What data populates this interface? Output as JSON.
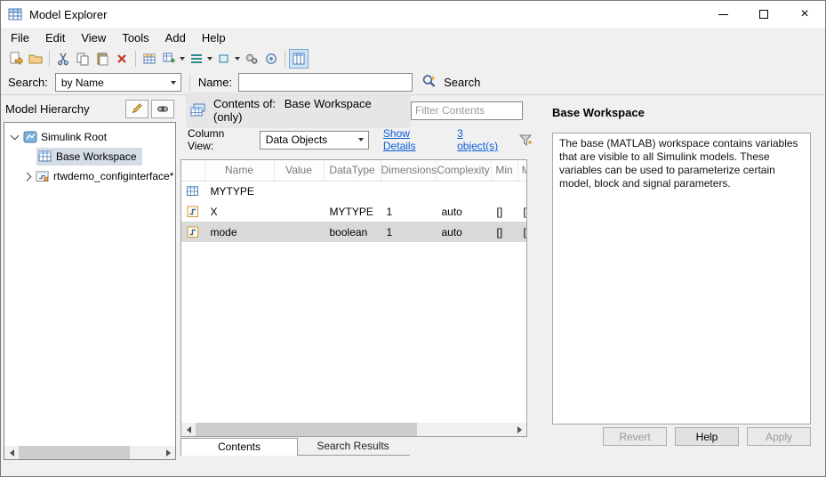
{
  "window": {
    "title": "Model Explorer"
  },
  "menu": {
    "items": [
      "File",
      "Edit",
      "View",
      "Tools",
      "Add",
      "Help"
    ]
  },
  "toolbar": {
    "icons": [
      "new-model-icon",
      "open-icon",
      "cut-icon",
      "copy-icon",
      "paste-icon",
      "delete-icon",
      "add-data-icon",
      "add-object-icon",
      "add-connection-icon",
      "add-block-icon",
      "gears-icon",
      "options-icon",
      "column-view-icon"
    ]
  },
  "searchbar": {
    "search_label": "Search:",
    "search_mode_value": "by Name",
    "name_label": "Name:",
    "name_value": "",
    "search_button_label": "Search"
  },
  "left_panel": {
    "title": "Model Hierarchy",
    "tree": [
      {
        "label": "Simulink Root"
      },
      {
        "label": "Base Workspace"
      },
      {
        "label": "rtwdemo_configinterface*"
      }
    ]
  },
  "center_panel": {
    "contents_of_label": "Contents of:",
    "contents_target": "Base Workspace",
    "contents_scope": "(only)",
    "filter_placeholder": "Filter Contents",
    "column_view_label": "Column View:",
    "column_view_value": "Data Objects",
    "show_details_link": "Show Details",
    "object_count_link": "3 object(s)",
    "table": {
      "headers": [
        "Name",
        "Value",
        "DataType",
        "Dimensions",
        "Complexity",
        "Min",
        "Max"
      ],
      "rows": [
        {
          "name": "MYTYPE",
          "value": "",
          "datatype": "",
          "dimensions": "",
          "complexity": "",
          "min": "",
          "max": ""
        },
        {
          "name": "X",
          "value": "",
          "datatype": "MYTYPE",
          "dimensions": "1",
          "complexity": "auto",
          "min": "[]",
          "max": "[]"
        },
        {
          "name": "mode",
          "value": "",
          "datatype": "boolean",
          "dimensions": "1",
          "complexity": "auto",
          "min": "[]",
          "max": "[]"
        }
      ]
    },
    "tabs": [
      "Contents",
      "Search Results"
    ]
  },
  "right_panel": {
    "title": "Base Workspace",
    "description": "The base (MATLAB) workspace contains variables that are visible to all Simulink models. These variables can be used to parameterize certain model, block and signal parameters.",
    "buttons": {
      "revert": "Revert",
      "help": "Help",
      "apply": "Apply"
    }
  }
}
